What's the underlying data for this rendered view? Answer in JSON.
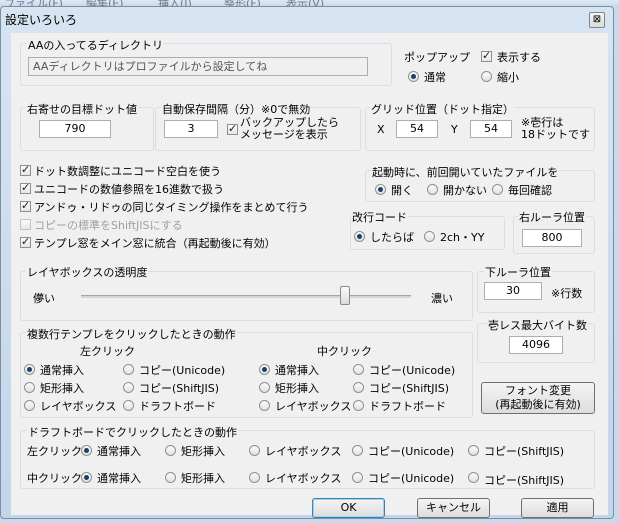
{
  "background_menu": {
    "items": [
      "ファイル(F)",
      "編集(E)",
      "挿入(I)",
      "整形(F)",
      "表示(V)"
    ]
  },
  "window": {
    "title": "設定いろいろ",
    "close_glyph": "⊠",
    "close_icon": "close-icon"
  },
  "aa_dir": {
    "label": "AAの入ってるディレクトリ",
    "value": "AAディレクトリはプロファイルから設定してね"
  },
  "popup": {
    "label": "ポップアップ",
    "show_label": "表示する",
    "show_checked": true,
    "normal_label": "通常",
    "shrink_label": "縮小",
    "selected": "normal"
  },
  "right_align": {
    "label": "右寄せの目標ドット値",
    "value": "790"
  },
  "autosave": {
    "label": "自動保存間隔（分）※0で無効",
    "value": "3",
    "backup_label_1": "バックアップしたら",
    "backup_label_2": "メッセージを表示",
    "backup_checked": true
  },
  "grid": {
    "label": "グリッド位置（ドット指定）",
    "x_label": "X",
    "x_value": "54",
    "y_label": "Y",
    "y_value": "54",
    "note_1": "※壱行は",
    "note_2": "18ドットです"
  },
  "options": [
    {
      "label": "ドット数調整にユニコード空白を使う",
      "checked": true,
      "disabled": false
    },
    {
      "label": "ユニコードの数値参照を16進数で扱う",
      "checked": true,
      "disabled": false
    },
    {
      "label": "アンドゥ・リドゥの同じタイミング操作をまとめて行う",
      "checked": true,
      "disabled": false
    },
    {
      "label": "コピーの標準をShiftJISにする",
      "checked": false,
      "disabled": true
    },
    {
      "label": "テンプレ窓をメイン窓に統合（再起動後に有効）",
      "checked": true,
      "disabled": false
    }
  ],
  "startup": {
    "label": "起動時に、前回開いていたファイルを",
    "options": [
      "開く",
      "開かない",
      "毎回確認"
    ],
    "selected": 0
  },
  "linebreak": {
    "label": "改行コード",
    "options": [
      "したらば",
      "2ch・YY"
    ],
    "selected": 0
  },
  "right_ruler": {
    "label": "右ルーラ位置",
    "value": "800"
  },
  "layer_transparency": {
    "label": "レイヤボックスの透明度",
    "left_label": "儚い",
    "right_label": "濃い",
    "value_fraction": 0.8
  },
  "bottom_ruler": {
    "label": "下ルーラ位置",
    "value": "30",
    "unit": "※行数"
  },
  "max_bytes": {
    "label": "壱レス最大バイト数",
    "value": "4096"
  },
  "multi_template": {
    "label": "複数行テンプレをクリックしたときの動作",
    "left_click_label": "左クリック",
    "middle_click_label": "中クリック",
    "options": [
      "通常挿入",
      "矩形挿入",
      "レイヤボックス",
      "コピー(Unicode)",
      "コピー(ShiftJIS)",
      "ドラフトボード"
    ],
    "left_selected": 0,
    "middle_selected": 0
  },
  "font_button": {
    "line1": "フォント変更",
    "line2": "(再起動後に有効)"
  },
  "draft_board": {
    "label": "ドラフトボードでクリックしたときの動作",
    "left_click_label": "左クリック",
    "middle_click_label": "中クリック",
    "options": [
      "通常挿入",
      "矩形挿入",
      "レイヤボックス",
      "コピー(Unicode)",
      "コピー(ShiftJIS)"
    ],
    "left_selected": 0,
    "middle_selected": 0
  },
  "buttons": {
    "ok": "OK",
    "cancel": "キャンセル",
    "apply": "適用"
  }
}
